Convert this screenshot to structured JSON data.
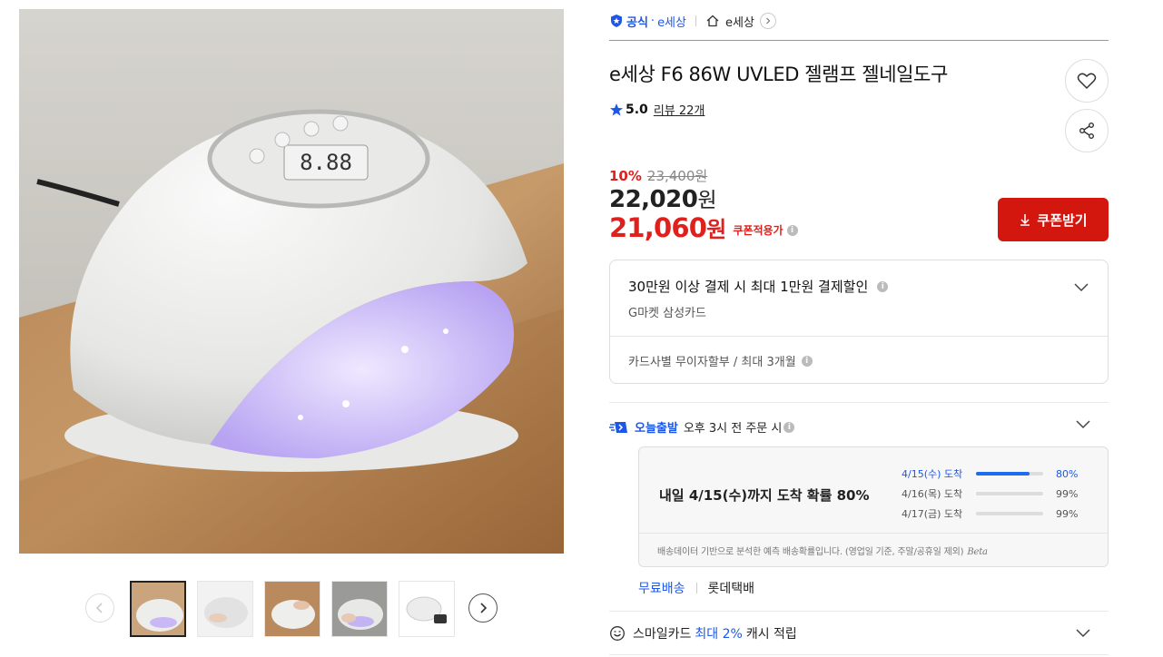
{
  "breadcrumb": {
    "official_label": "공식",
    "official_store": "e세상",
    "store_name": "e세상"
  },
  "product": {
    "title": "e세상 F6 86W UVLED 젤램프 젤네일도구",
    "rating": "5.0",
    "review_text": "리뷰 22개"
  },
  "price": {
    "discount_rate": "10%",
    "original": "23,400원",
    "sale_amount": "22,020",
    "sale_unit": "원",
    "coupon_amount": "21,060",
    "coupon_unit": "원",
    "coupon_tag": "쿠폰적용가",
    "coupon_button": "쿠폰받기"
  },
  "benefit": {
    "title": "30만원 이상 결제 시 최대 1만원 결제할인",
    "card": "G마켓 삼성카드",
    "installment": "카드사별 무이자할부 / 최대 3개월"
  },
  "delivery": {
    "today_label": "오늘출발",
    "today_desc": "오후 3시 전 주문 시",
    "headline": "내일 4/15(수)까지 도착 확률 80%",
    "rows": [
      {
        "date": "4/15(수) 도착",
        "pct": "80%",
        "value": 0.8
      },
      {
        "date": "4/16(목) 도착",
        "pct": "99%",
        "value": 0.99
      },
      {
        "date": "4/17(금) 도착",
        "pct": "99%",
        "value": 0.99
      }
    ],
    "note": "배송데이터 기반으로 분석한 예측 배송확률입니다. (영업일 기준, 주말/공휴일 제외)",
    "beta": "Beta",
    "free_shipping": "무료배송",
    "carrier": "롯데택배"
  },
  "smile": {
    "prefix": "스마일카드",
    "highlight": "최대 2%",
    "suffix": "캐시 적립"
  },
  "colors": {
    "accent_blue": "#1d57e8",
    "sale_red": "#e0201c",
    "button_red": "#d3170f"
  },
  "icons": [
    "official-badge-icon",
    "home-icon",
    "chevron-right-icon",
    "heart-icon",
    "share-icon",
    "star-icon",
    "info-icon",
    "download-icon",
    "chevron-down-icon",
    "truck-icon",
    "smile-icon",
    "chevron-left-icon"
  ]
}
